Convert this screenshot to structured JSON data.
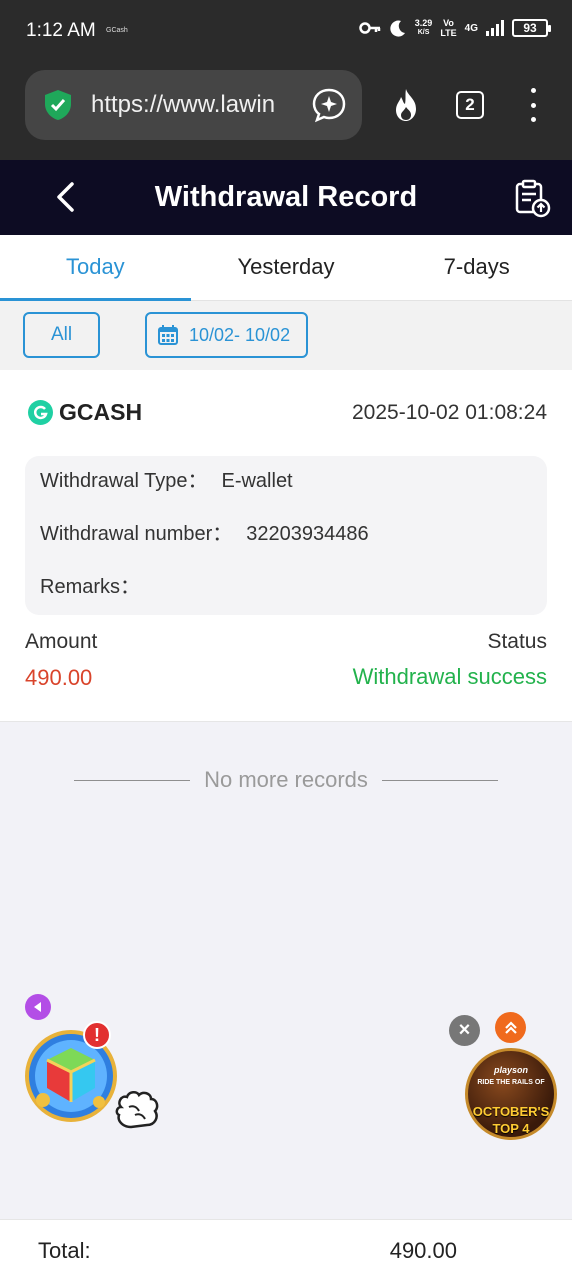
{
  "status_bar": {
    "time": "1:12 AM",
    "carrier_label": "GCash",
    "net_speed_value": "3.29",
    "net_speed_unit": "K/S",
    "volte_top": "Vo",
    "volte_bottom": "LTE",
    "signal_type": "4G",
    "battery": "93"
  },
  "browser": {
    "url": "https://www.lawin",
    "tab_count": "2"
  },
  "header": {
    "title": "Withdrawal Record"
  },
  "tabs": [
    {
      "label": "Today",
      "active": true
    },
    {
      "label": "Yesterday",
      "active": false
    },
    {
      "label": "7-days",
      "active": false
    }
  ],
  "filters": {
    "all_label": "All",
    "date_range": "10/02- 10/02"
  },
  "record": {
    "method": "GCASH",
    "datetime": "2025-10-02 01:08:24",
    "type_label": "Withdrawal Type：",
    "type_value": "E-wallet",
    "number_label": "Withdrawal number：",
    "number_value": "32203934486",
    "remarks_label": "Remarks：",
    "remarks_value": "",
    "amount_label": "Amount",
    "amount_value": "490.00",
    "status_label": "Status",
    "status_value": "Withdrawal success"
  },
  "list_end": {
    "text": "No more records"
  },
  "floating": {
    "badge": "!",
    "promo_line1": "playson",
    "promo_line2": "RIDE THE RAILS OF",
    "promo_line3": "OCTOBER'S",
    "promo_line4": "TOP 4"
  },
  "footer": {
    "total_label": "Total:",
    "total_value": "490.00"
  },
  "colors": {
    "accent": "#2a93d5",
    "header_bg": "#0d0c23",
    "amount": "#d9442b",
    "success": "#22b24c"
  }
}
